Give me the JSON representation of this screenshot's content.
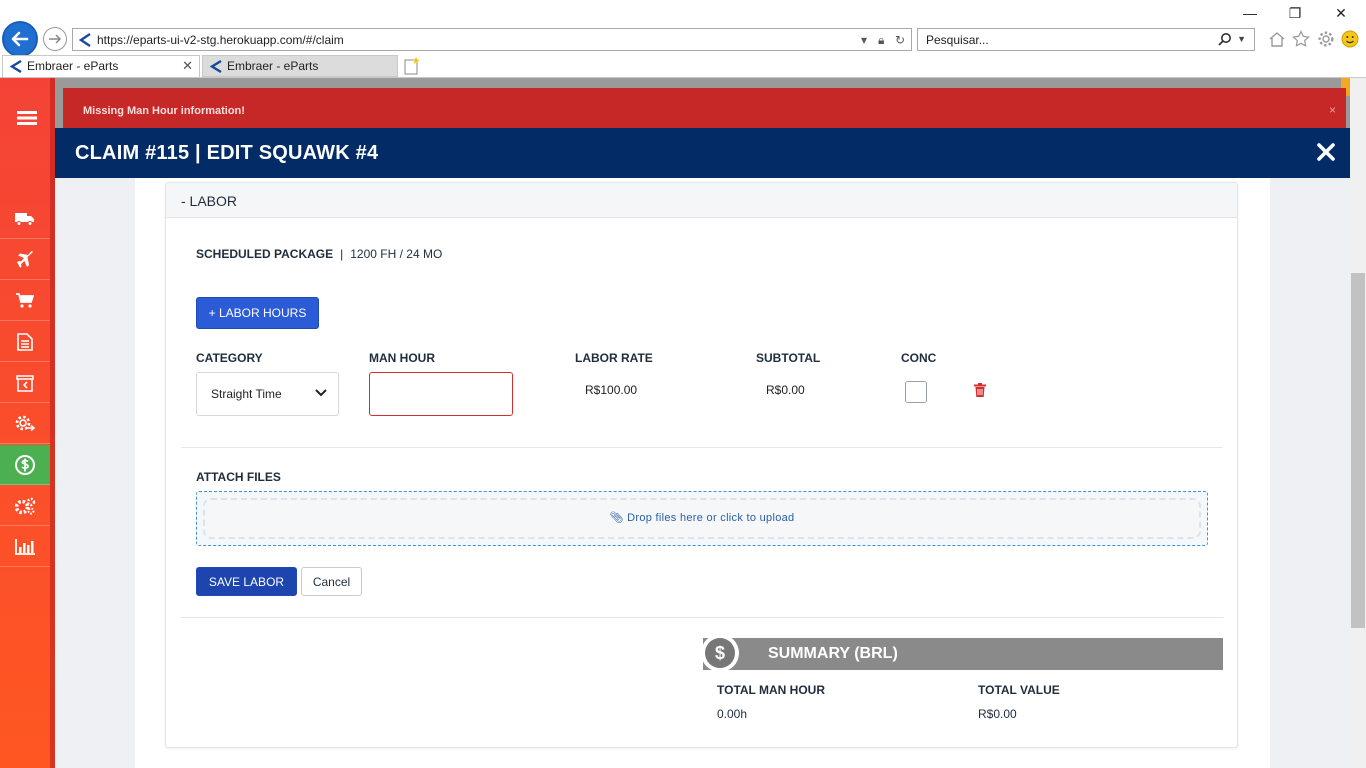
{
  "browser": {
    "url": "https://eparts-ui-v2-stg.herokuapp.com/#/claim",
    "search_placeholder": "Pesquisar...",
    "tabs": [
      {
        "label": "Embraer - eParts"
      },
      {
        "label": "Embraer - eParts"
      }
    ],
    "window_controls": {
      "minimize": "—",
      "restore": "❐",
      "close": "✕"
    }
  },
  "alert": {
    "message": "Missing Man Hour information!",
    "close": "×"
  },
  "modal": {
    "title": "CLAIM #115 | EDIT SQUAWK #4"
  },
  "sidebar": {
    "items": [
      {
        "icon": "menu-icon"
      },
      {
        "icon": "truck-icon"
      },
      {
        "icon": "airplane-icon"
      },
      {
        "icon": "cart-icon"
      },
      {
        "icon": "document-icon"
      },
      {
        "icon": "box-return-icon"
      },
      {
        "icon": "gear-arrows-icon"
      },
      {
        "icon": "dollar-icon",
        "active": true
      },
      {
        "icon": "gears-icon"
      },
      {
        "icon": "bar-chart-icon"
      }
    ]
  },
  "labor": {
    "section_title": "- LABOR",
    "scheduled_label": "SCHEDULED PACKAGE",
    "scheduled_sep": "|",
    "scheduled_value": "1200 FH / 24 MO",
    "add_button": "+ LABOR HOURS",
    "columns": {
      "category": "CATEGORY",
      "man_hour": "MAN HOUR",
      "labor_rate": "LABOR RATE",
      "subtotal": "SUBTOTAL",
      "conc": "CONC"
    },
    "row": {
      "category": "Straight Time",
      "man_hour": "",
      "labor_rate": "R$100.00",
      "subtotal": "R$0.00",
      "conc_checked": false
    },
    "attach_title": "ATTACH FILES",
    "dropzone_text": "Drop files here or click to upload",
    "save_button": "SAVE LABOR",
    "cancel_button": "Cancel"
  },
  "summary": {
    "title": "SUMMARY (BRL)",
    "currency_symbol": "$",
    "total_man_hour_label": "TOTAL MAN HOUR",
    "total_man_hour_value": "0.00h",
    "total_value_label": "TOTAL VALUE",
    "total_value_value": "R$0.00"
  },
  "colors": {
    "header_navy": "#032b66",
    "alert_red": "#c62828",
    "primary_blue": "#2c5bd8",
    "sidebar_active": "#4caf50"
  }
}
